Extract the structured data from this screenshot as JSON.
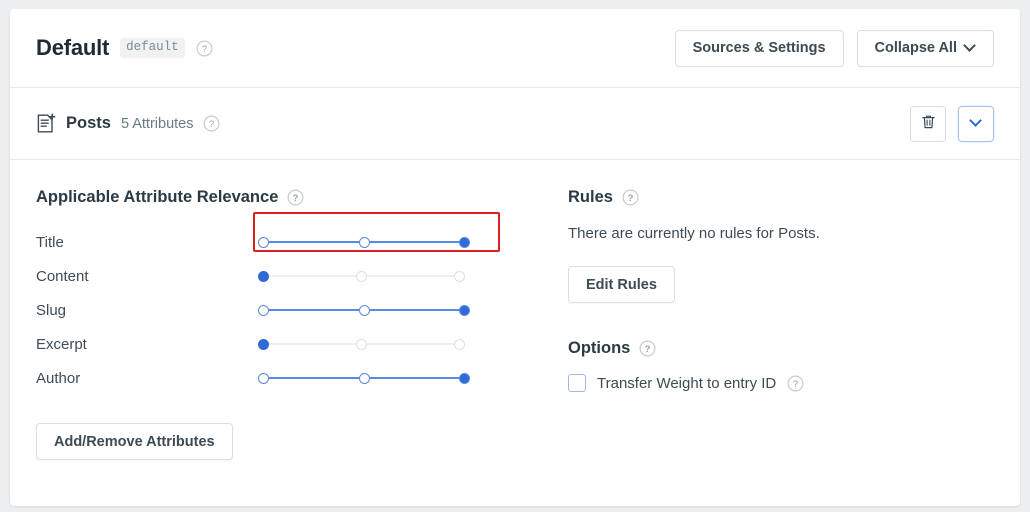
{
  "header": {
    "title": "Default",
    "badge": "default",
    "help_icon": "help-circle-icon",
    "sources_settings_label": "Sources & Settings",
    "collapse_all_label": "Collapse All",
    "chevron_icon": "chevron-down-icon"
  },
  "section": {
    "icon": "document-plus-icon",
    "name": "Posts",
    "meta": "5 Attributes",
    "help_icon": "help-circle-icon",
    "delete_icon": "trash-icon",
    "collapse_icon": "chevron-down-icon"
  },
  "relevance": {
    "heading": "Applicable Attribute Relevance",
    "help_icon": "help-circle-icon",
    "stops": 3,
    "attributes": [
      {
        "label": "Title",
        "value": 3,
        "active": true,
        "highlighted": true
      },
      {
        "label": "Content",
        "value": 1,
        "active": false,
        "highlighted": false
      },
      {
        "label": "Slug",
        "value": 3,
        "active": true,
        "highlighted": false
      },
      {
        "label": "Excerpt",
        "value": 1,
        "active": false,
        "highlighted": false
      },
      {
        "label": "Author",
        "value": 3,
        "active": true,
        "highlighted": false
      }
    ],
    "add_remove_label": "Add/Remove Attributes"
  },
  "rules": {
    "heading": "Rules",
    "help_icon": "help-circle-icon",
    "empty_text": "There are currently no rules for Posts.",
    "edit_label": "Edit Rules"
  },
  "options": {
    "heading": "Options",
    "help_icon": "help-circle-icon",
    "transfer_weight_label": "Transfer Weight to entry ID",
    "transfer_weight_checked": false,
    "transfer_help_icon": "help-circle-icon"
  },
  "colors": {
    "accent": "#2f6ad9",
    "track_active": "#5b8ae0",
    "track_inactive": "#eceef0",
    "highlight": "#e02020",
    "text": "#3d4b54",
    "heading": "#2b3a44",
    "page_bg": "#eceef0"
  }
}
